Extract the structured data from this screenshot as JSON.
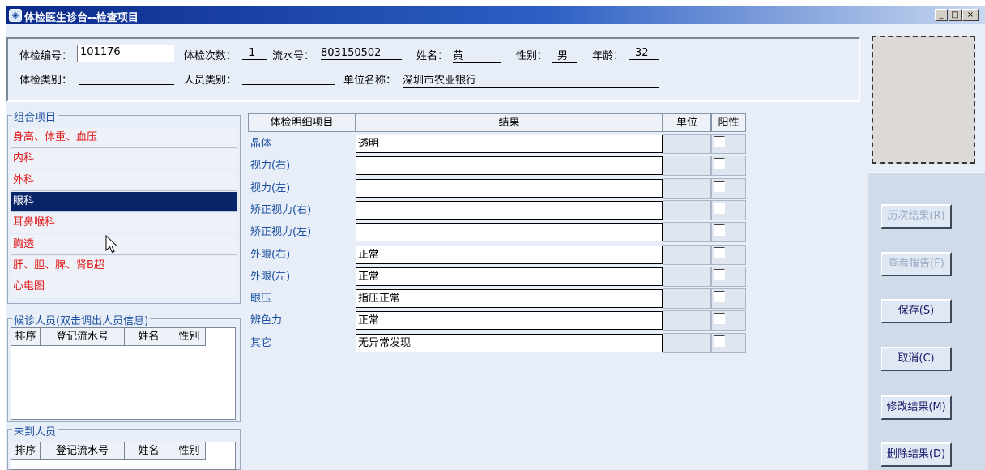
{
  "window": {
    "title": "体检医生诊台--检查项目",
    "min_symbol": "_",
    "max_symbol": "□",
    "close_symbol": "×"
  },
  "header": {
    "exam_no_label": "体检编号：",
    "exam_no_value": "101176",
    "exam_count_label": "体检次数：",
    "exam_count_value": "1",
    "serial_label": "流水号：",
    "serial_value": "803150502",
    "name_label": "姓名：",
    "name_value": "黄",
    "gender_label": "性别：",
    "gender_value": "男",
    "age_label": "年龄：",
    "age_value": "32",
    "exam_type_label": "体检类别：",
    "exam_type_value": "",
    "person_type_label": "人员类别：",
    "person_type_value": "",
    "unit_label": "单位名称：",
    "unit_value": "深圳市农业银行"
  },
  "combo": {
    "title": "组合项目",
    "items": [
      {
        "label": "身高、体重、血压"
      },
      {
        "label": "内科"
      },
      {
        "label": "外科"
      },
      {
        "label": "眼科"
      },
      {
        "label": "耳鼻喉科"
      },
      {
        "label": "胸透"
      },
      {
        "label": "肝、胆、脾、肾B超"
      },
      {
        "label": "心电图"
      }
    ],
    "selected": "眼科"
  },
  "waiting": {
    "title": "候诊人员(双击调出人员信息)",
    "headers": [
      "排序",
      "登记流水号",
      "姓名",
      "性别"
    ]
  },
  "absent": {
    "title": "未到人员",
    "headers": [
      "排序",
      "登记流水号",
      "姓名",
      "性别"
    ]
  },
  "table": {
    "headers": [
      "体检明细项目",
      "结果",
      "单位",
      "阳性"
    ],
    "rows": [
      {
        "item": "晶体",
        "result": "透明",
        "unit": ""
      },
      {
        "item": "视力(右)",
        "result": "",
        "unit": ""
      },
      {
        "item": "视力(左)",
        "result": "",
        "unit": ""
      },
      {
        "item": "矫正视力(右)",
        "result": "",
        "unit": ""
      },
      {
        "item": "矫正视力(左)",
        "result": "",
        "unit": ""
      },
      {
        "item": "外眼(右)",
        "result": "正常",
        "unit": ""
      },
      {
        "item": "外眼(左)",
        "result": "正常",
        "unit": ""
      },
      {
        "item": "眼压",
        "result": "指压正常",
        "unit": ""
      },
      {
        "item": "辨色力",
        "result": "正常",
        "unit": ""
      },
      {
        "item": "其它",
        "result": "无异常发现",
        "unit": ""
      }
    ]
  },
  "buttons": {
    "history": "历次结果(R)",
    "report": "查看报告(F)",
    "save": "保存(S)",
    "cancel": "取消(C)",
    "modify": "修改结果(M)",
    "delete": "删除结果(D)"
  },
  "colors": {
    "title_bar": "#0a2a8a",
    "selected_row": "#0a246a",
    "combo_text": "#e01818",
    "item_text": "#1a4fa0",
    "panel_bg": "#e8eef7"
  }
}
